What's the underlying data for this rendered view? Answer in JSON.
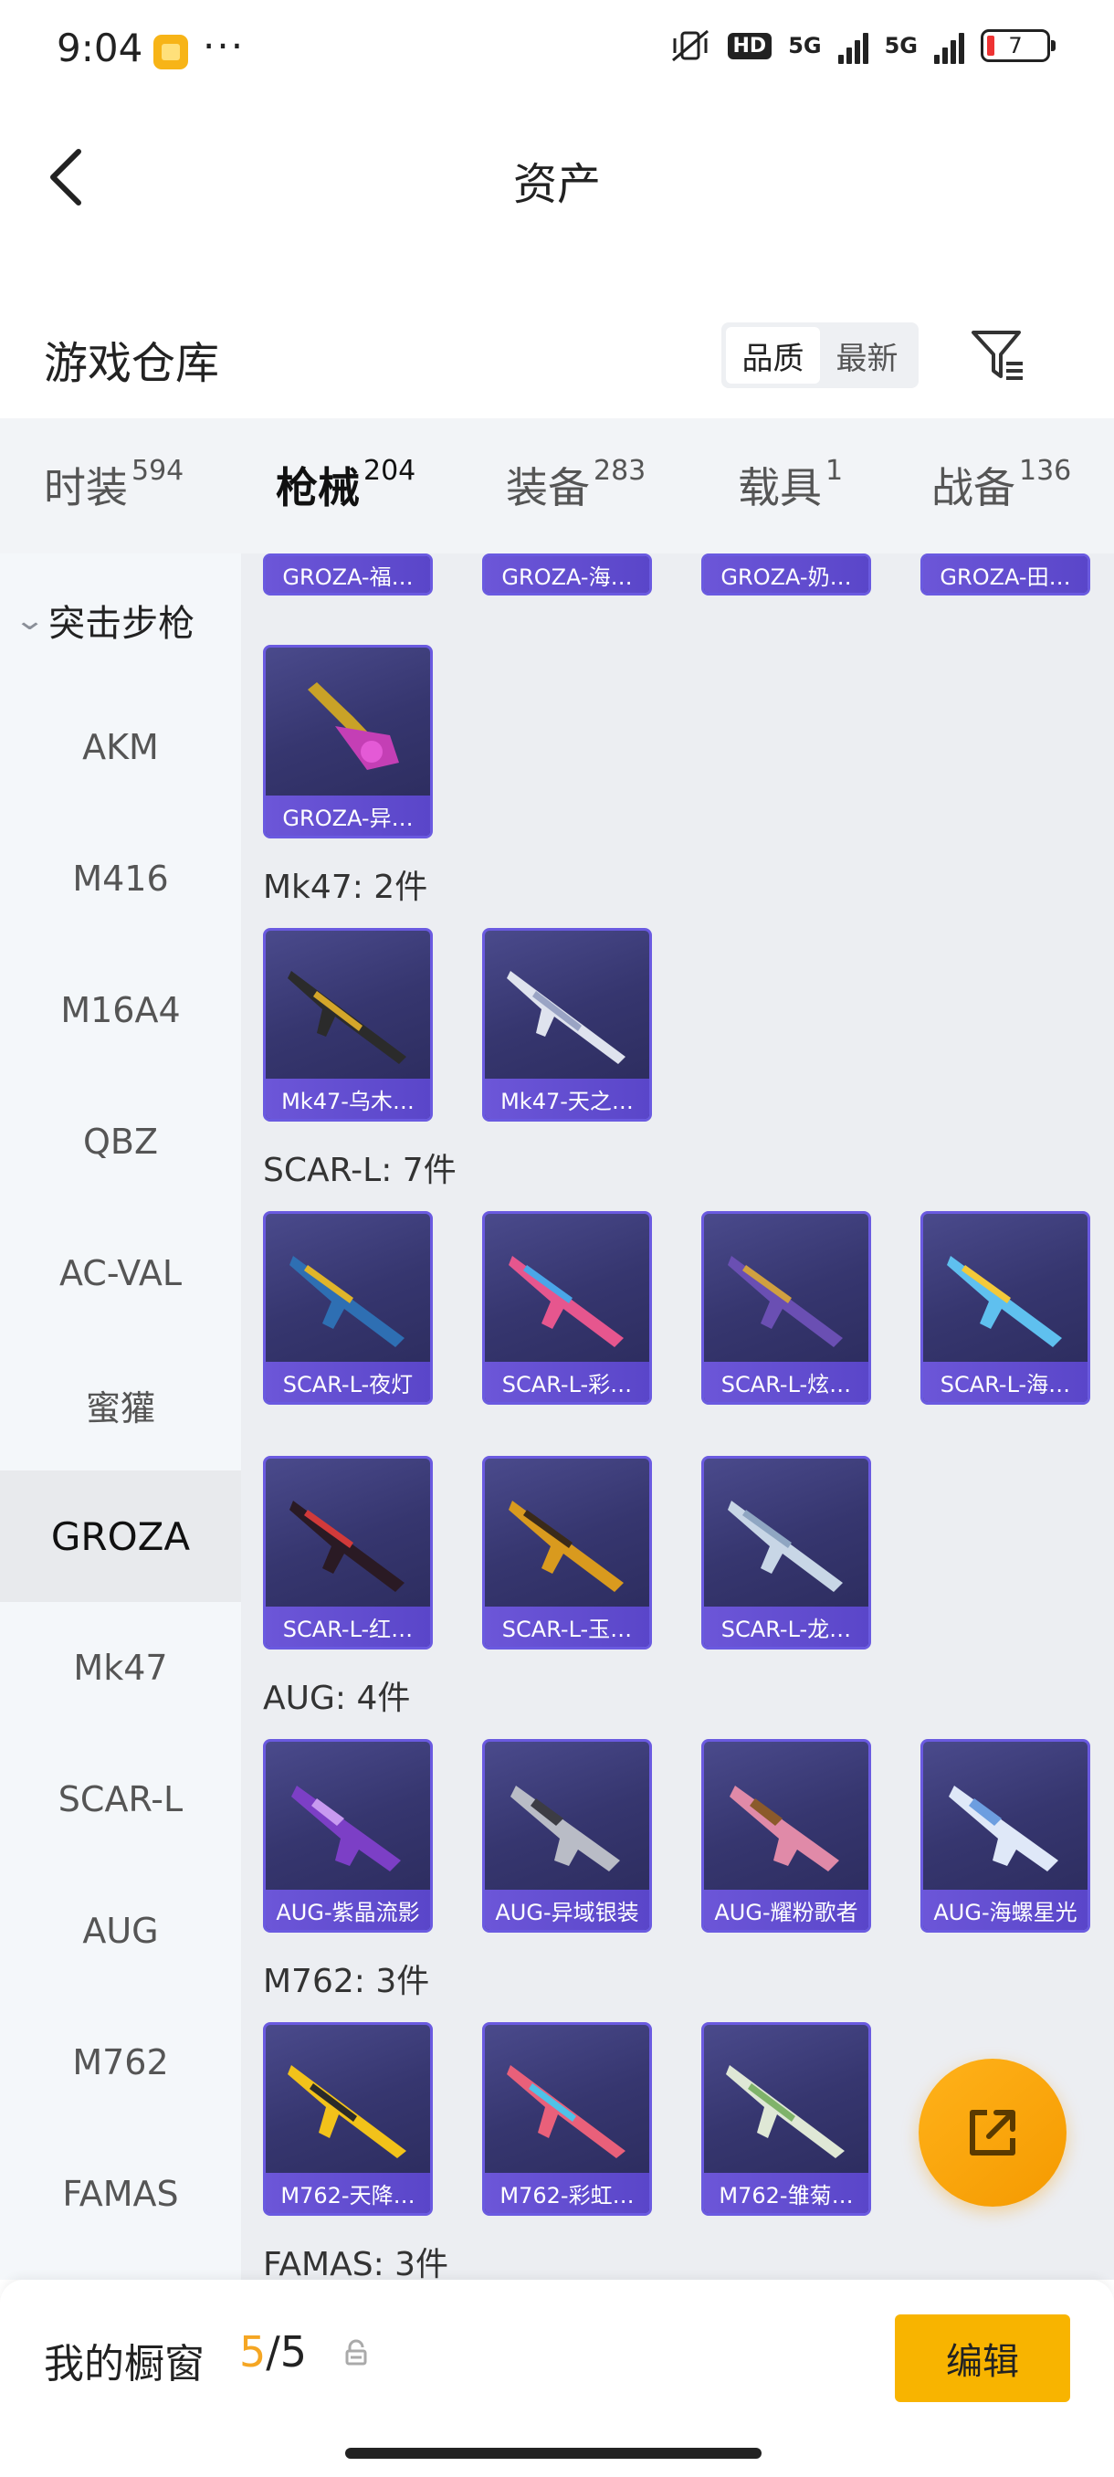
{
  "status_bar": {
    "time": "9:04",
    "dots": "···",
    "hd": "HD",
    "net1": "5G",
    "net2": "5G",
    "battery": "7"
  },
  "header": {
    "title": "资产"
  },
  "section": {
    "title": "游戏仓库",
    "sort_options": [
      "品质",
      "最新"
    ],
    "sort_selected": "品质"
  },
  "tabs": [
    {
      "label": "时装",
      "count": "594"
    },
    {
      "label": "枪械",
      "count": "204"
    },
    {
      "label": "装备",
      "count": "283"
    },
    {
      "label": "载具",
      "count": "1"
    },
    {
      "label": "战备",
      "count": "136"
    }
  ],
  "sidebar": {
    "group": "突击步枪",
    "items": [
      "AKM",
      "M416",
      "M16A4",
      "QBZ",
      "AC-VAL",
      "蜜獾",
      "GROZA",
      "Mk47",
      "SCAR-L",
      "AUG",
      "M762",
      "FAMAS"
    ],
    "selected": "GROZA"
  },
  "groups": {
    "groza_top": [
      "GROZA-福…",
      "GROZA-海…",
      "GROZA-奶…",
      "GROZA-田…"
    ],
    "groza_more": [
      "GROZA-异…"
    ],
    "mk47": {
      "header": "Mk47: 2件",
      "items": [
        "Mk47-乌木…",
        "Mk47-天之…"
      ]
    },
    "scarl": {
      "header": "SCAR-L: 7件",
      "items": [
        "SCAR-L-夜灯",
        "SCAR-L-彩…",
        "SCAR-L-炫…",
        "SCAR-L-海…",
        "SCAR-L-红…",
        "SCAR-L-玉…",
        "SCAR-L-龙…"
      ]
    },
    "aug": {
      "header": "AUG: 4件",
      "items": [
        "AUG-紫晶流影",
        "AUG-异域银装",
        "AUG-耀粉歌者",
        "AUG-海螺星光"
      ]
    },
    "m762": {
      "header": "M762: 3件",
      "items": [
        "M762-天降…",
        "M762-彩虹…",
        "M762-雏菊…"
      ]
    },
    "famas": {
      "header": "FAMAS: 3件"
    }
  },
  "bottom_bar": {
    "label": "我的橱窗",
    "count_current": "5",
    "count_sep": "/5",
    "edit_label": "编辑"
  },
  "colors": {
    "accent": "#f5a623",
    "card_border": "#6a5ae0",
    "card_label": "#6c56d8"
  },
  "icons": {
    "back": "back-arrow-icon",
    "filter": "filter-icon",
    "share": "share-external-icon",
    "lock": "lock-icon"
  }
}
